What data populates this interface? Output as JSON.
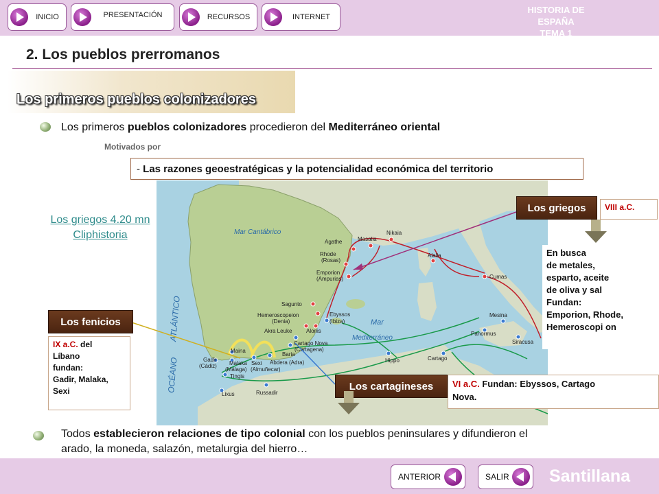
{
  "nav": {
    "inicio": "INICIO",
    "presentacion": "PRESENTACIÓN",
    "recursos": "RECURSOS",
    "internet": "INTERNET",
    "brand_line1": "HISTORIA DE ESPAÑA",
    "brand_line2": "TEMA 1"
  },
  "page": {
    "title": "2. Los pueblos prerromanos",
    "section": "Los primeros pueblos colonizadores"
  },
  "intro": {
    "prefix": "Los primeros ",
    "bold1": "pueblos colonizadores",
    "middle": " procedieron del ",
    "bold2": "Mediterráneo oriental",
    "motivados": "Motivados por",
    "reasons_dash": "- ",
    "reasons": "Las razones geoestratégicas y la potencialidad económica del territorio"
  },
  "link": {
    "line1": "Los griegos 4.20 mn",
    "line2": "Cliphistoria"
  },
  "griegos": {
    "tag": "Los griegos",
    "date": "VIII a.C.",
    "desc_lines": [
      "En busca",
      "de metales,",
      "esparto, aceite",
      "de oliva y sal",
      "Fundan:",
      "Emporion, Rhode,",
      "Hemeroscopi on"
    ]
  },
  "fenicios": {
    "tag": "Los fenicios",
    "date": "IX a.C.",
    "date_rest": " del",
    "desc_lines": [
      "Líbano",
      "fundan:",
      "Gadir, Malaka,",
      "Sexi"
    ]
  },
  "cartagineses": {
    "tag": "Los cartagineses",
    "date": "VI a.C.",
    "desc": " Fundan: Ebyssos, Cartago",
    "desc2": "Nova."
  },
  "map": {
    "sea_cantabrico": "Mar Cantábrico",
    "ocean1": "OCÉANO",
    "ocean2": "ATLÁNTICO",
    "sea_mar": "Mar",
    "sea_med": "Mediterráneo",
    "cities": {
      "agathe": "Agathe",
      "masalia": "Masalia",
      "nikaia": "Nikaia",
      "rhode": "Rhode",
      "rosas": "(Rosas)",
      "emporion": "Emporion",
      "ampurias": "(Ampurias)",
      "alalia": "Alalia",
      "cumas": "Cumas",
      "sagunto": "Sagunto",
      "hemeroscopeion": "Hemeroscopeion",
      "denia": "(Denia)",
      "akra": "Akra Leuke",
      "alonis": "Alonis",
      "ebyssos": "Ebyssos",
      "ibiza": "(Ibiza)",
      "cartago_nova": "Cartago Nova",
      "cartagena": "(Cartagena)",
      "baria": "Baria",
      "abdera": "Abdera (Adra)",
      "sexi": "Sexi",
      "almunecar": "(Almuñecar)",
      "malaka": "Malaka",
      "malaga": "(Málaga)",
      "gadir": "Gadir",
      "cadiz": "(Cádiz)",
      "maina": "Maina",
      "tingis": "Tingis",
      "lixus": "Lixus",
      "russadir": "Russadir",
      "hippo": "Hippo",
      "cartago": "Cartago",
      "mesina": "Mesina",
      "panormus": "Panormus",
      "siracusa": "Siracusa"
    }
  },
  "conclusion": {
    "prefix": "Todos ",
    "bold": "establecieron relaciones de tipo colonial",
    "rest": " con los pueblos peninsulares y difundieron el",
    "line2": "arado, la moneda, salazón, metalurgia del hierro…"
  },
  "footer": {
    "anterior": "ANTERIOR",
    "salir": "SALIR",
    "brand": "Santillana"
  },
  "colors": {
    "band": "#e6cbe6",
    "accent": "#8a1f8a",
    "tag_brown": "#5a2d14",
    "route_red": "#c0202a",
    "route_green": "#1a9a4a"
  }
}
